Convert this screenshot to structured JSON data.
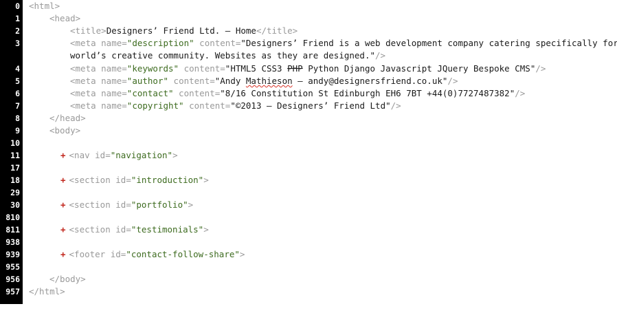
{
  "gutter": {
    "line_numbers": [
      "0",
      "1",
      "2",
      "3",
      "",
      "4",
      "5",
      "6",
      "7",
      "8",
      "9",
      "10",
      "11",
      "17",
      "18",
      "29",
      "30",
      "810",
      "811",
      "938",
      "939",
      "955",
      "956",
      "957"
    ]
  },
  "code": {
    "html_open": "<html>",
    "head_open": "<head>",
    "title_open": "<title>",
    "title_text": "Designers’ Friend Ltd. — Home",
    "title_close": "</title>",
    "meta_open": "<meta name=",
    "content_attr": " content=",
    "self_close": "/>",
    "desc_name": "\"description\"",
    "desc_content_a": "\"Designers’ Friend is a web development company catering specifically for the",
    "desc_content_b": "world’s creative community. Websites as they are designed.\"",
    "keywords_name": "\"keywords\"",
    "keywords_content_a": "\"HTML5 CSS3 ",
    "keywords_content_struck": "PHP",
    "keywords_content_b": " Python Django Javascript JQuery Bespoke CMS\"",
    "author_name": "\"author\"",
    "author_content_a": "\"Andy ",
    "author_content_misspelled": "Mathieson",
    "author_content_b": " — andy@designersfriend.co.uk\"",
    "contact_name": "\"contact\"",
    "contact_content": "\"8/16 Constitution St Edinburgh EH6 7BT +44(0)7727487382\"",
    "copyright_name": "\"copyright\"",
    "copyright_content": "\"©2013 — Designers’ Friend Ltd\"",
    "head_close": "</head>",
    "body_open": "<body>",
    "fold_symbol": "+",
    "nav_open": "<nav id=",
    "nav_id": "\"navigation\"",
    "section_open": "<section id=",
    "intro_id": "\"introduction\"",
    "portfolio_id": "\"portfolio\"",
    "testimonials_id": "\"testimonials\"",
    "footer_open": "<footer id=",
    "footer_id": "\"contact-follow-share\"",
    "tag_end": ">",
    "body_close": "</body>",
    "html_close": "</html>"
  }
}
